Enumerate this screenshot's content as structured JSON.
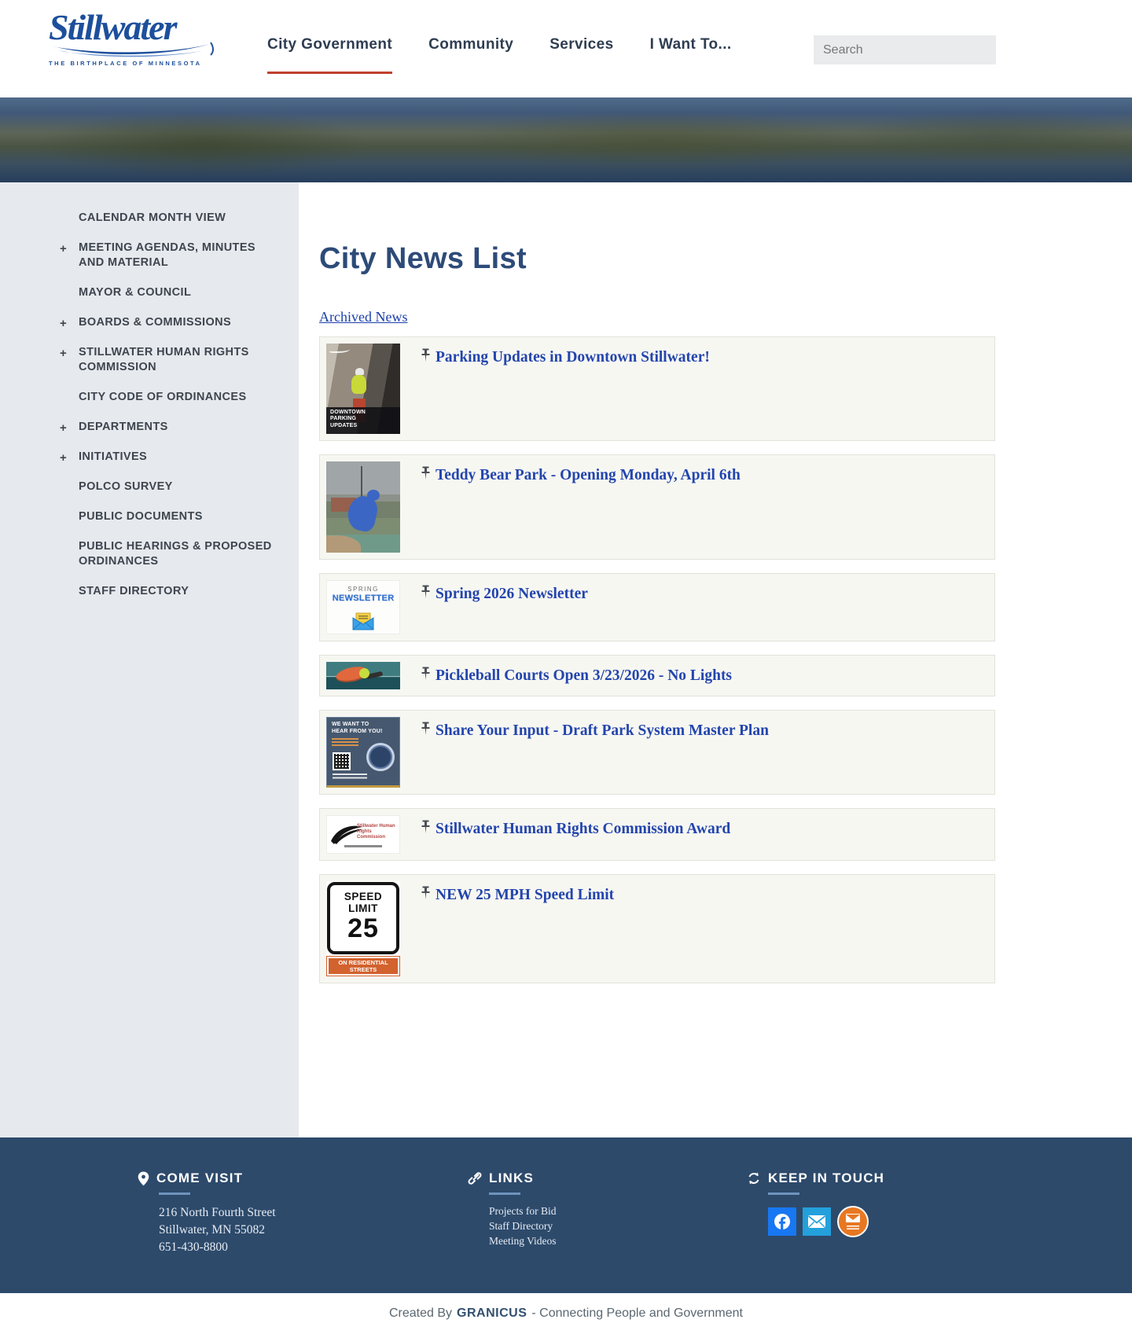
{
  "colors": {
    "accent_red": "#c0402e",
    "news_title_blue": "#2345ad",
    "footer_bg": "#2d4a6b",
    "sidebar_bg": "#e6e9ed",
    "facebook_blue": "#1877f2",
    "email_blue": "#24a0dc",
    "signup_orange": "#e87722",
    "logo_blue": "#1d4f9c"
  },
  "header": {
    "logo": {
      "title": "Stillwater",
      "tagline": "THE BIRTHPLACE OF MINNESOTA"
    },
    "nav": [
      {
        "label": "City Government"
      },
      {
        "label": "Community"
      },
      {
        "label": "Services"
      },
      {
        "label": "I Want To..."
      }
    ],
    "search": {
      "placeholder": "Search"
    }
  },
  "sidebar": {
    "plus": "+",
    "items": [
      {
        "label": "CALENDAR MONTH VIEW"
      },
      {
        "label": "MEETING AGENDAS, MINUTES AND MATERIAL"
      },
      {
        "label": "MAYOR & COUNCIL"
      },
      {
        "label": "BOARDS & COMMISSIONS"
      },
      {
        "label": "STILLWATER HUMAN RIGHTS COMMISSION"
      },
      {
        "label": "CITY CODE OF ORDINANCES"
      },
      {
        "label": "DEPARTMENTS"
      },
      {
        "label": "INITIATIVES"
      },
      {
        "label": "POLCO SURVEY"
      },
      {
        "label": "PUBLIC DOCUMENTS"
      },
      {
        "label": "PUBLIC HEARINGS & PROPOSED ORDINANCES"
      },
      {
        "label": "STAFF DIRECTORY"
      }
    ]
  },
  "main": {
    "title": "City News List",
    "archived_link": "Archived News",
    "news": [
      {
        "title": "Parking Updates in Downtown Stillwater!",
        "thumb_caption": "DOWNTOWN\nPARKING\nUPDATES"
      },
      {
        "title": "Teddy Bear Park - Opening Monday, April 6th"
      },
      {
        "title": "Spring 2026 Newsletter",
        "thumb_top": "SPRING",
        "thumb_main": "NEWSLETTER"
      },
      {
        "title": "Pickleball Courts Open 3/23/2026 - No Lights"
      },
      {
        "title": "Share Your Input - Draft Park System Master Plan",
        "thumb_heading": "WE WANT TO\nHEAR FROM YOU!"
      },
      {
        "title": "Stillwater Human Rights Commission Award",
        "thumb_caption": "Stillwater Human\nRights Commission"
      },
      {
        "title": "NEW 25 MPH Speed Limit",
        "sign_top": "SPEED\nLIMIT",
        "sign_number": "25",
        "sign_bottom": "ON RESIDENTIAL\nSTREETS"
      }
    ]
  },
  "footer": {
    "come_visit": {
      "heading": "COME VISIT",
      "lines": [
        "216 North Fourth Street",
        "Stillwater, MN 55082",
        "651-430-8800"
      ]
    },
    "links": {
      "heading": "LINKS",
      "items": [
        {
          "label": "Projects for Bid"
        },
        {
          "label": "Staff Directory"
        },
        {
          "label": "Meeting Videos"
        }
      ]
    },
    "keep_in_touch": {
      "heading": "KEEP IN TOUCH"
    }
  },
  "bottom_bar": {
    "created_by": "Created By",
    "brand": "GRANICUS",
    "tagline": "- Connecting People and Government"
  }
}
